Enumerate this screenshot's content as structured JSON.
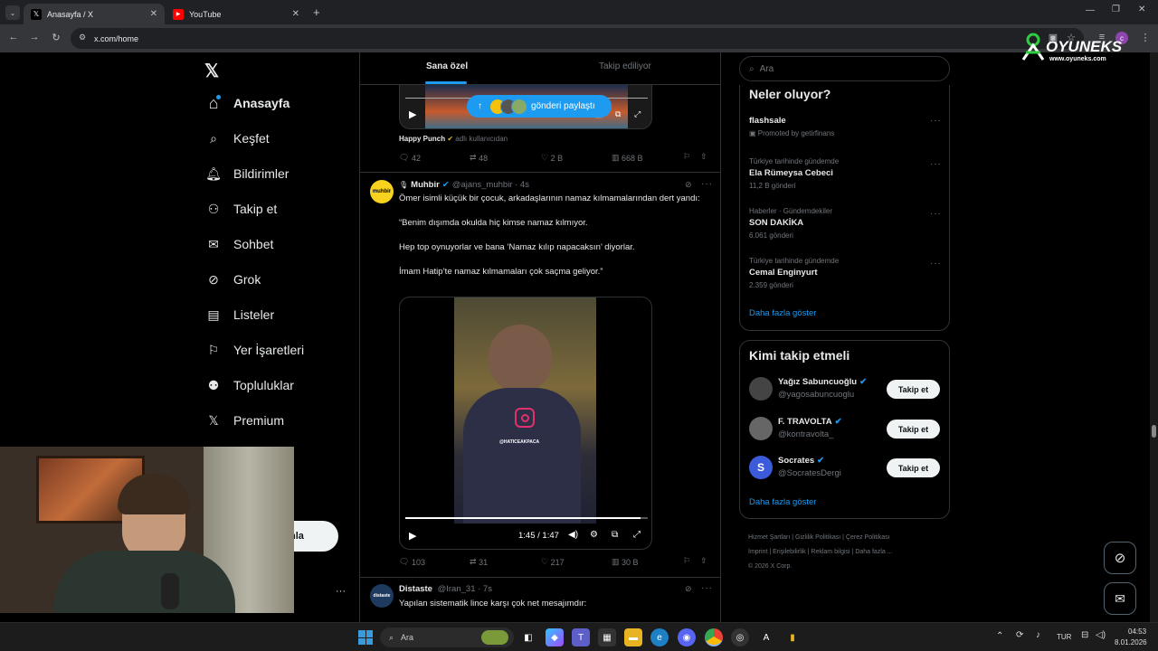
{
  "browser": {
    "tabs": [
      {
        "title": "Anasayfa / X",
        "active": true
      },
      {
        "title": "YouTube",
        "active": false
      }
    ],
    "url": "x.com/home"
  },
  "watermark": {
    "brand": "OYUNEKS",
    "site": "www.oyuneks.com"
  },
  "sidebar": {
    "items": [
      {
        "label": "Anasayfa",
        "icon": "home-icon"
      },
      {
        "label": "Keşfet",
        "icon": "search-icon"
      },
      {
        "label": "Bildirimler",
        "icon": "bell-icon"
      },
      {
        "label": "Takip et",
        "icon": "follow-icon"
      },
      {
        "label": "Sohbet",
        "icon": "mail-icon"
      },
      {
        "label": "Grok",
        "icon": "grok-icon"
      },
      {
        "label": "Listeler",
        "icon": "list-icon"
      },
      {
        "label": "Yer İşaretleri",
        "icon": "bookmark-icon"
      },
      {
        "label": "Topluluklar",
        "icon": "communities-icon"
      },
      {
        "label": "Premium",
        "icon": "x-icon"
      }
    ],
    "post_partial": "nla"
  },
  "timeline": {
    "tabs": [
      "Sana özel",
      "Takip ediliyor"
    ],
    "shared_pill": "gönderi paylaştı",
    "tweet1": {
      "author": "Happy Punch",
      "handle_note": "adlı kullanıcıdan",
      "replies": "42",
      "reposts": "48",
      "likes": "2 B",
      "views": "668 B"
    },
    "tweet2": {
      "name": "Muhbir",
      "handle": "@ajans_muhbir · 4s",
      "avatar_text": "muhbir",
      "p1": "Ömer isimli küçük bir çocuk, arkadaşlarının namaz kılmamalarından dert yandı:",
      "p2": "“Benim dışımda okulda hiç kimse namaz kılmıyor.",
      "p3": "Hep top oynuyorlar ve bana ‘Namaz kılıp napacaksın’ diyorlar.",
      "p4": "İmam Hatip’te namaz kılmamaları çok saçma geliyor.”",
      "video_tag": "@HATICEAKPACA",
      "video_time": "1:45 / 1:47",
      "video_progress": 0.97,
      "replies": "103",
      "reposts": "31",
      "likes": "217",
      "views": "30 B"
    },
    "tweet3": {
      "name": "Distaste",
      "handle": "@Iran_31 · 7s",
      "avatar_text": "distaste",
      "text": "Yapılan sistematik lince karşı çok net mesajımdır:"
    }
  },
  "right": {
    "search_placeholder": "Ara",
    "trends_title": "Neler oluyor?",
    "trends": [
      {
        "context": "",
        "name": "flashsale",
        "meta": "Promoted by getirfinans"
      },
      {
        "context": "Türkiye tarihinde gündemde",
        "name": "Ela Rümeysa Cebeci",
        "meta": "11,2 B gönderi"
      },
      {
        "context": "Haberler · Gündemdekiler",
        "name": "SON DAKİKA",
        "meta": "6.061 gönderi"
      },
      {
        "context": "Türkiye tarihinde gündemde",
        "name": "Cemal Enginyurt",
        "meta": "2.359 gönderi"
      }
    ],
    "show_more": "Daha fazla göster",
    "who_title": "Kimi takip etmeli",
    "who": [
      {
        "name": "Yağız Sabuncuoğlu",
        "handle": "@yagosabuncuoglu",
        "button": "Takip et"
      },
      {
        "name": "F. TRAVOLTA",
        "handle": "@kontravolta_",
        "button": "Takip et"
      },
      {
        "name": "Socrates",
        "handle": "@SocratesDergi",
        "button": "Takip et"
      }
    ],
    "who_more": "Daha fazla göster",
    "footer_line1": [
      "Hizmet Şartları",
      "Gizlilik Politikası",
      "Çerez Politikası"
    ],
    "footer_line2": [
      "İmprint",
      "Erişilebilirlik",
      "Reklam bilgisi",
      "Daha fazla ..."
    ],
    "copyright": "© 2026 X Corp."
  },
  "taskbar": {
    "search": "Ara",
    "lang": "TUR",
    "time": "04:53",
    "date": "8.01.2026"
  },
  "colors": {
    "accent": "#1d9bf0",
    "bg": "#000000",
    "border": "#2f3336",
    "muted": "#71767b"
  }
}
